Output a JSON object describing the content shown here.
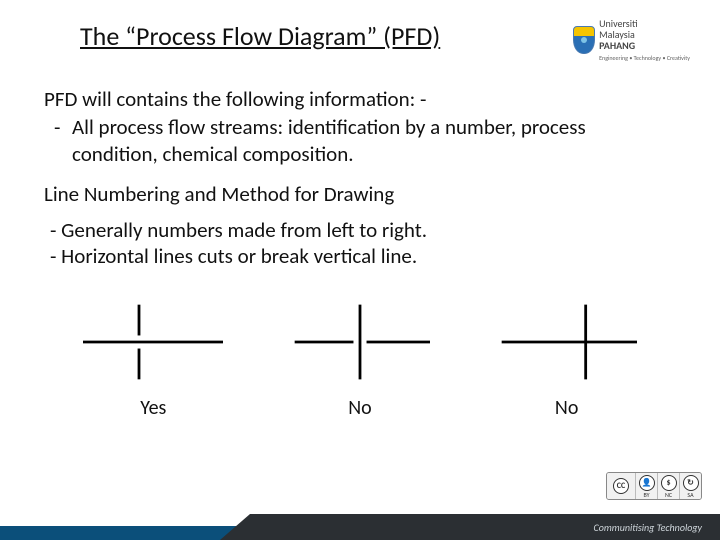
{
  "title": "The “Process Flow Diagram” (PFD)",
  "logo": {
    "line1": "Universiti",
    "line2": "Malaysia",
    "line3": "PAHANG",
    "tag": "Engineering • Technology • Creativity"
  },
  "intro": "PFD will contains the following information: -",
  "bullet": "All process flow streams: identification by a number, process condition, chemical composition.",
  "subhead": "Line Numbering and Method for Drawing",
  "note1": "- Generally numbers made from left to right.",
  "note2": "- Horizontal lines cuts or break vertical line.",
  "labels": {
    "yes": "Yes",
    "no1": "No",
    "no2": "No"
  },
  "cc": {
    "cc": "CC",
    "by": "BY",
    "nc": "NC",
    "sa": "SA"
  },
  "footer_tag": "Communitising Technology"
}
